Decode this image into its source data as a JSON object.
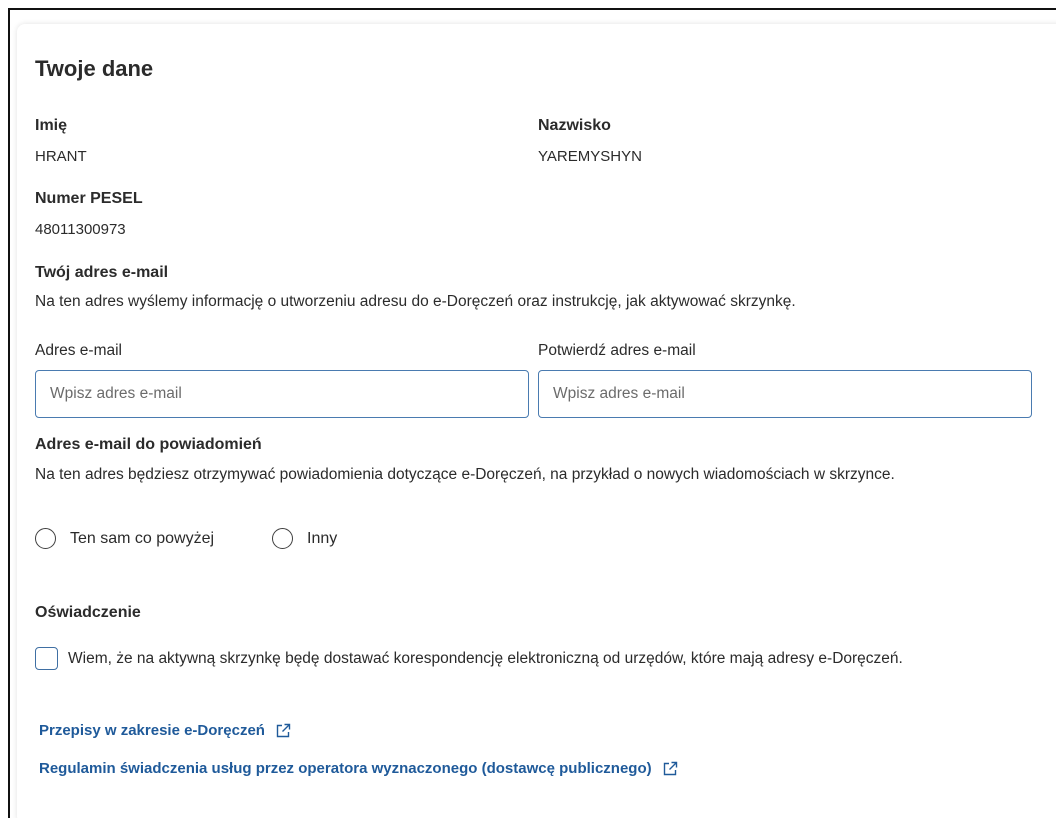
{
  "section": {
    "title": "Twoje dane"
  },
  "person": {
    "first_name_label": "Imię",
    "first_name_value": "HRANT",
    "last_name_label": "Nazwisko",
    "last_name_value": "YAREMYSHYN",
    "pesel_label": "Numer PESEL",
    "pesel_value": "48011300973"
  },
  "email": {
    "heading": "Twój adres e-mail",
    "description": "Na ten adres wyślemy informację o utworzeniu adresu do e-Doręczeń oraz instrukcję, jak aktywować skrzynkę.",
    "email_label": "Adres e-mail",
    "email_placeholder": "Wpisz adres e-mail",
    "email_value": "",
    "confirm_label": "Potwierdź adres e-mail",
    "confirm_placeholder": "Wpisz adres e-mail",
    "confirm_value": ""
  },
  "notification": {
    "heading": "Adres e-mail do powiadomień",
    "description": "Na ten adres będziesz otrzymywać powiadomienia dotyczące e-Doręczeń, na przykład o nowych wiadomościach w skrzynce.",
    "options": [
      {
        "label": "Ten sam co powyżej",
        "selected": false
      },
      {
        "label": "Inny",
        "selected": false
      }
    ]
  },
  "statement": {
    "heading": "Oświadczenie",
    "checkbox_label": "Wiem, że na aktywną skrzynkę będę dostawać korespondencję elektroniczną od urzędów, które mają adresy e-Doręczeń.",
    "checked": false
  },
  "links": [
    {
      "label": "Przepisy w zakresie e-Doręczeń",
      "icon": "external-link-icon"
    },
    {
      "label": "Regulamin świadczenia usług przez operatora wyznaczonego (dostawcę publicznego)",
      "icon": "external-link-icon"
    }
  ],
  "colors": {
    "link": "#1f5a9a",
    "input_border": "#4a7bb0",
    "text": "#2b2b2b"
  }
}
